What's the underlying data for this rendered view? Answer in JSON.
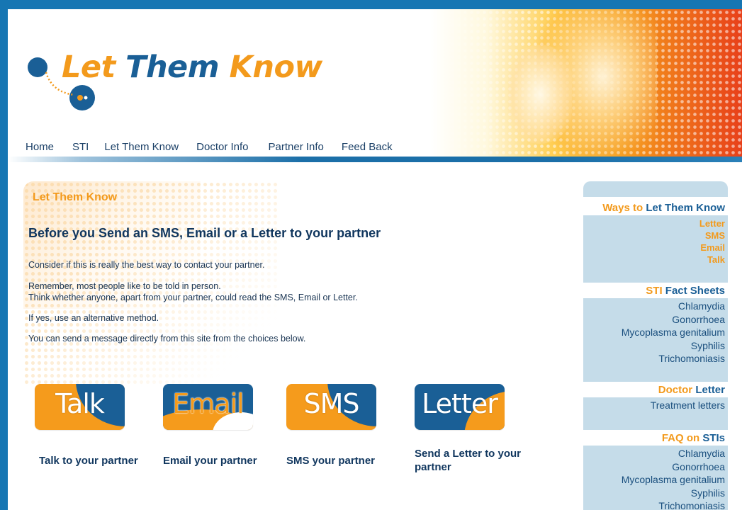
{
  "header": {
    "logo": {
      "word1": "Let",
      "word2": "Them",
      "word3": "Know"
    },
    "nav": [
      "Home",
      "STI",
      "Let Them Know",
      "Doctor Info",
      "Partner Info",
      "Feed Back"
    ]
  },
  "main": {
    "section_label": "Let Them Know",
    "heading": "Before you Send an SMS, Email or a Letter to your partner",
    "paragraphs": {
      "p1": "Consider if this is really the best way to contact your partner.",
      "p2a": "Remember, most people like to be told in person.",
      "p2b": "Think whether anyone, apart from your partner, could read the SMS, Email or Letter.",
      "p3": "If yes, use an alternative method.",
      "p4": "You can send a message directly from this site from the choices below."
    },
    "methods": [
      {
        "badge": "Talk",
        "caption": "Talk to your partner",
        "colors": {
          "base": "#f59b1c",
          "accent": "#1a5f96"
        }
      },
      {
        "badge": "Email",
        "caption": "Email your partner",
        "colors": {
          "base": "#1a5f96",
          "accent": "#f59b1c"
        }
      },
      {
        "badge": "SMS",
        "caption": "SMS your partner",
        "colors": {
          "base": "#f59b1c",
          "accent": "#1a5f96"
        }
      },
      {
        "badge": "Letter",
        "caption": "Send a Letter to your partner",
        "colors": {
          "base": "#1a5f96",
          "accent": "#f59b1c"
        }
      }
    ]
  },
  "sidebar": {
    "ways": {
      "title_a": "Ways to",
      "title_b": "Let Them Know",
      "links": [
        "Letter",
        "SMS",
        "Email",
        "Talk"
      ]
    },
    "facts": {
      "title_a": "STI",
      "title_b": "Fact Sheets",
      "links": [
        "Chlamydia",
        "Gonorrhoea",
        "Mycoplasma genitalium",
        "Syphilis",
        "Trichomoniasis"
      ]
    },
    "doctor": {
      "title_a": "Doctor",
      "title_b": "Letter",
      "links": [
        "Treatment letters"
      ]
    },
    "faq": {
      "title_a": "FAQ on",
      "title_b": "STIs",
      "links": [
        "Chlamydia",
        "Gonorrhoea",
        "Mycoplasma genitalium",
        "Syphilis",
        "Trichomoniasis"
      ]
    }
  },
  "colors": {
    "brand_orange": "#f39a1c",
    "brand_blue": "#1a5f96",
    "sidebar_bg": "#c5dce9",
    "frame_blue": "#1676b3"
  }
}
